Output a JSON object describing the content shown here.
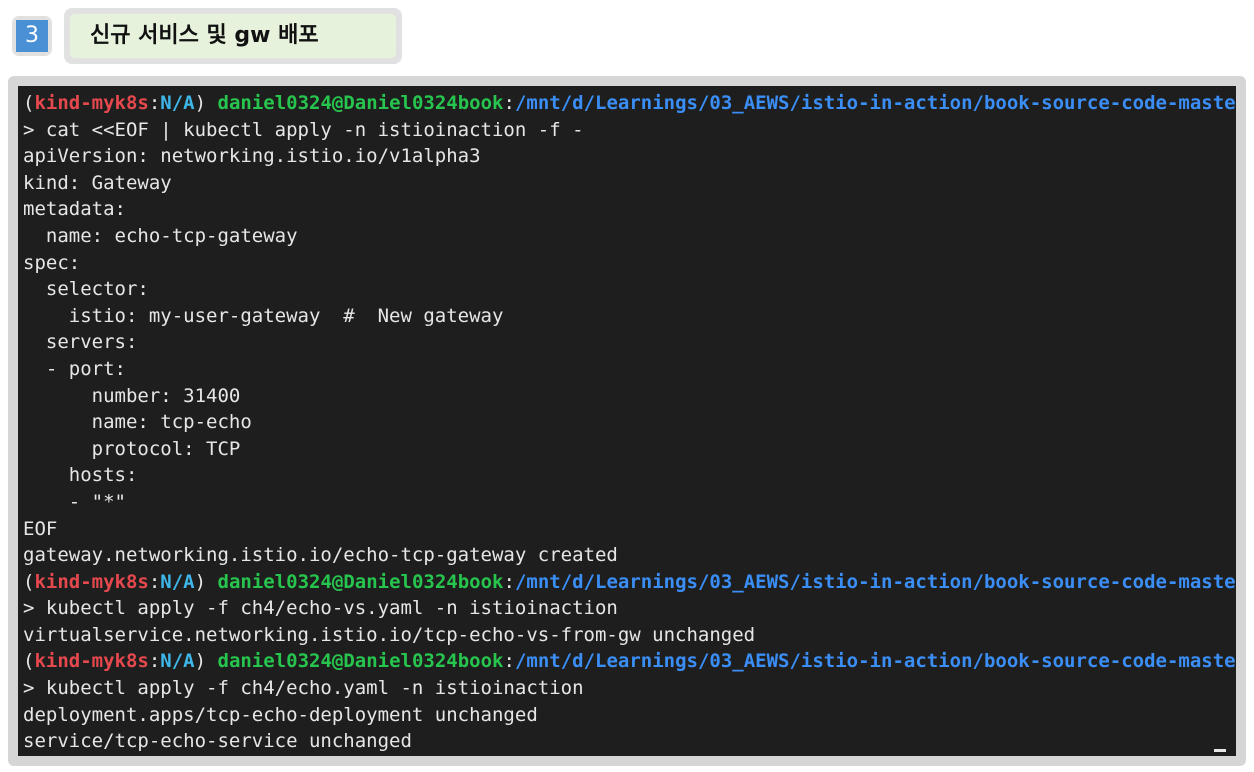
{
  "header": {
    "step_number": "3",
    "title": "신규 서비스 및 gw 배포"
  },
  "terminal": {
    "lines": [
      "(kind-myk8s:N/A) daniel0324@Daniel0324book:/mnt/d/Learnings/03_AEWS/istio-in-action/book-source-code-master$ \\",
      "> cat <<EOF | kubectl apply -n istioinaction -f -",
      "apiVersion: networking.istio.io/v1alpha3",
      "kind: Gateway",
      "metadata:",
      "  name: echo-tcp-gateway",
      "spec:",
      "  selector:",
      "    istio: my-user-gateway  #  New gateway",
      "  servers:",
      "  - port:",
      "      number: 31400",
      "      name: tcp-echo",
      "      protocol: TCP",
      "    hosts:",
      "    - \"*\"",
      "EOF",
      "gateway.networking.istio.io/echo-tcp-gateway created",
      "(kind-myk8s:N/A) daniel0324@Daniel0324book:/mnt/d/Learnings/03_AEWS/istio-in-action/book-source-code-master$ \\",
      "> kubectl apply -f ch4/echo-vs.yaml -n istioinaction",
      "virtualservice.networking.istio.io/tcp-echo-vs-from-gw unchanged",
      "(kind-myk8s:N/A) daniel0324@Daniel0324book:/mnt/d/Learnings/03_AEWS/istio-in-action/book-source-code-master$ \\",
      "> kubectl apply -f ch4/echo.yaml -n istioinaction",
      "deployment.apps/tcp-echo-deployment unchanged",
      "service/tcp-echo-service unchanged"
    ]
  },
  "colors": {
    "terminal_bg": "#1e1e1e",
    "prompt_context": "#e5484d",
    "prompt_namespace": "#3fb6e8",
    "prompt_user": "#27c44e",
    "prompt_path": "#3a8ef6",
    "badge": "#4a90d4",
    "title_bg": "#e6f2dc"
  }
}
